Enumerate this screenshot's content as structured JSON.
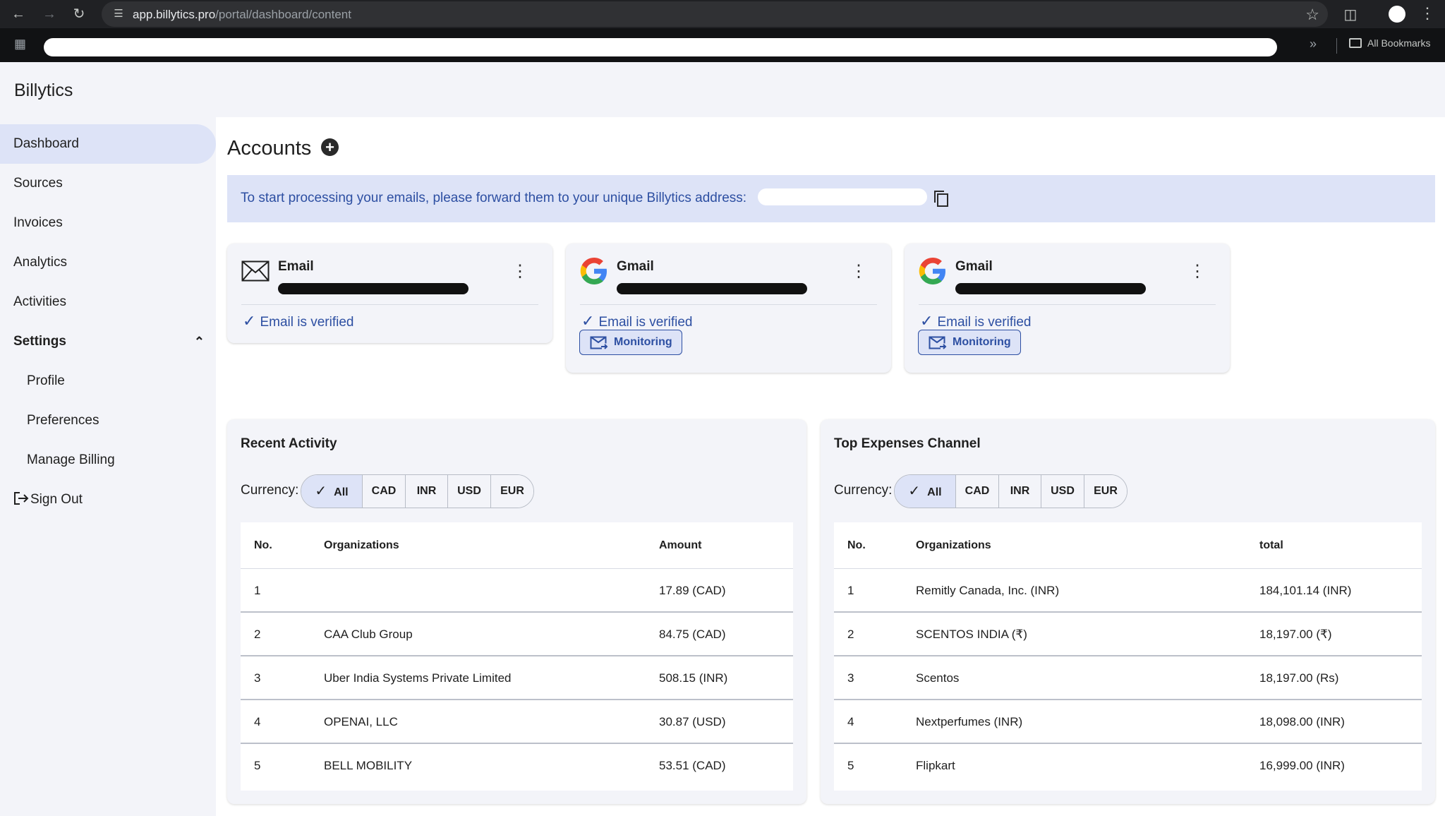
{
  "browser": {
    "url_host": "app.billytics.pro",
    "url_path": "/portal/dashboard/content",
    "bookmarks_label": "All Bookmarks"
  },
  "app": {
    "brand": "Billytics"
  },
  "sidebar": {
    "items": [
      {
        "label": "Dashboard"
      },
      {
        "label": "Sources"
      },
      {
        "label": "Invoices"
      },
      {
        "label": "Analytics"
      },
      {
        "label": "Activities"
      },
      {
        "label": "Settings"
      },
      {
        "label": "Profile"
      },
      {
        "label": "Preferences"
      },
      {
        "label": "Manage Billing"
      },
      {
        "label": "Sign Out"
      }
    ]
  },
  "main": {
    "title": "Accounts",
    "banner": "To start processing your emails, please forward them to your unique Billytics address:",
    "accounts": [
      {
        "type": "Email",
        "status": "Email is verified"
      },
      {
        "type": "Gmail",
        "status": "Email is verified",
        "button": "Monitoring"
      },
      {
        "type": "Gmail",
        "status": "Email is verified",
        "button": "Monitoring"
      }
    ]
  },
  "recent_activity": {
    "title": "Recent Activity",
    "currency_label": "Currency:",
    "currency_options": [
      "All",
      "CAD",
      "INR",
      "USD",
      "EUR"
    ],
    "selected_currency": "All",
    "columns": [
      "No.",
      "Organizations",
      "Amount"
    ],
    "rows": [
      {
        "no": "1",
        "org": "",
        "amount": "17.89 (CAD)"
      },
      {
        "no": "2",
        "org": "CAA Club Group",
        "amount": "84.75 (CAD)"
      },
      {
        "no": "3",
        "org": "Uber India Systems Private Limited",
        "amount": "508.15 (INR)"
      },
      {
        "no": "4",
        "org": "OPENAI, LLC",
        "amount": "30.87 (USD)"
      },
      {
        "no": "5",
        "org": "BELL MOBILITY",
        "amount": "53.51 (CAD)"
      }
    ]
  },
  "top_expenses": {
    "title": "Top Expenses Channel",
    "currency_label": "Currency:",
    "currency_options": [
      "All",
      "CAD",
      "INR",
      "USD",
      "EUR"
    ],
    "selected_currency": "All",
    "columns": [
      "No.",
      "Organizations",
      "total"
    ],
    "rows": [
      {
        "no": "1",
        "org": "Remitly Canada, Inc. (INR)",
        "amount": "184,101.14 (INR)"
      },
      {
        "no": "2",
        "org": "SCENTOS INDIA (₹)",
        "amount": "18,197.00 (₹)"
      },
      {
        "no": "3",
        "org": "Scentos",
        "amount": "18,197.00 (Rs)"
      },
      {
        "no": "4",
        "org": "Nextperfumes (INR)",
        "amount": "18,098.00 (INR)"
      },
      {
        "no": "5",
        "org": "Flipkart",
        "amount": "16,999.00 (INR)"
      }
    ]
  },
  "colors": {
    "accent": "#2d4fa2",
    "selected_bg": "#dde3f7"
  }
}
